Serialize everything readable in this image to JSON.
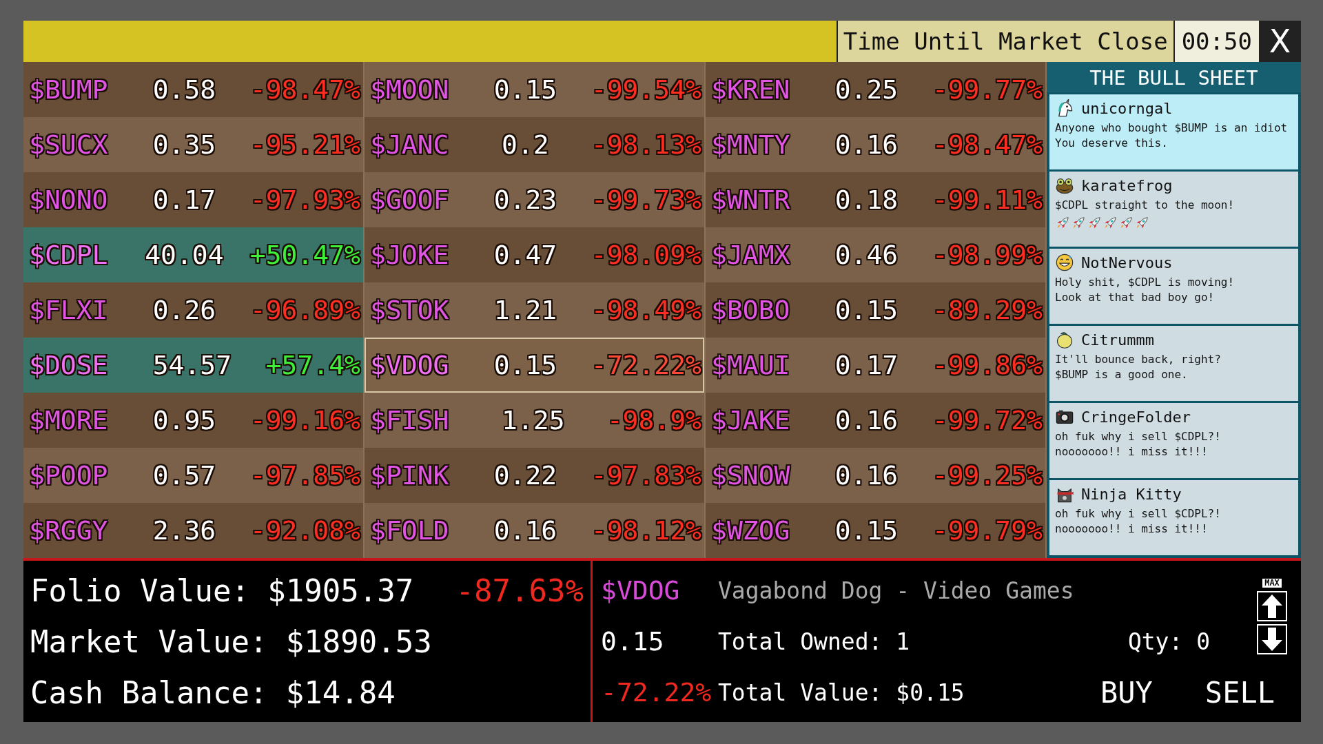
{
  "top_bar": {
    "label": "Time Until Market Close",
    "timer": "00:50",
    "close": "X"
  },
  "stocks": [
    {
      "ticker": "$BUMP",
      "price": "0.58",
      "change": "-98.47%",
      "rising": false,
      "selected": false
    },
    {
      "ticker": "$MOON",
      "price": "0.15",
      "change": "-99.54%",
      "rising": false,
      "selected": false
    },
    {
      "ticker": "$KREN",
      "price": "0.25",
      "change": "-99.77%",
      "rising": false,
      "selected": false
    },
    {
      "ticker": "$SUCX",
      "price": "0.35",
      "change": "-95.21%",
      "rising": false,
      "selected": false
    },
    {
      "ticker": "$JANC",
      "price": "0.2",
      "change": "-98.13%",
      "rising": false,
      "selected": false
    },
    {
      "ticker": "$MNTY",
      "price": "0.16",
      "change": "-98.47%",
      "rising": false,
      "selected": false
    },
    {
      "ticker": "$NONO",
      "price": "0.17",
      "change": "-97.93%",
      "rising": false,
      "selected": false
    },
    {
      "ticker": "$GOOF",
      "price": "0.23",
      "change": "-99.73%",
      "rising": false,
      "selected": false
    },
    {
      "ticker": "$WNTR",
      "price": "0.18",
      "change": "-99.11%",
      "rising": false,
      "selected": false
    },
    {
      "ticker": "$CDPL",
      "price": "40.04",
      "change": "+50.47%",
      "rising": true,
      "selected": false
    },
    {
      "ticker": "$JOKE",
      "price": "0.47",
      "change": "-98.09%",
      "rising": false,
      "selected": false
    },
    {
      "ticker": "$JAMX",
      "price": "0.46",
      "change": "-98.99%",
      "rising": false,
      "selected": false
    },
    {
      "ticker": "$FLXI",
      "price": "0.26",
      "change": "-96.89%",
      "rising": false,
      "selected": false
    },
    {
      "ticker": "$STOK",
      "price": "1.21",
      "change": "-98.49%",
      "rising": false,
      "selected": false
    },
    {
      "ticker": "$BOBO",
      "price": "0.15",
      "change": "-89.29%",
      "rising": false,
      "selected": false
    },
    {
      "ticker": "$DOSE",
      "price": "54.57",
      "change": "+57.4%",
      "rising": true,
      "selected": false
    },
    {
      "ticker": "$VDOG",
      "price": "0.15",
      "change": "-72.22%",
      "rising": false,
      "selected": true
    },
    {
      "ticker": "$MAUI",
      "price": "0.17",
      "change": "-99.86%",
      "rising": false,
      "selected": false
    },
    {
      "ticker": "$MORE",
      "price": "0.95",
      "change": "-99.16%",
      "rising": false,
      "selected": false
    },
    {
      "ticker": "$FISH",
      "price": "1.25",
      "change": "-98.9%",
      "rising": false,
      "selected": false
    },
    {
      "ticker": "$JAKE",
      "price": "0.16",
      "change": "-99.72%",
      "rising": false,
      "selected": false
    },
    {
      "ticker": "$POOP",
      "price": "0.57",
      "change": "-97.85%",
      "rising": false,
      "selected": false
    },
    {
      "ticker": "$PINK",
      "price": "0.22",
      "change": "-97.83%",
      "rising": false,
      "selected": false
    },
    {
      "ticker": "$SNOW",
      "price": "0.16",
      "change": "-99.25%",
      "rising": false,
      "selected": false
    },
    {
      "ticker": "$RGGY",
      "price": "2.36",
      "change": "-92.08%",
      "rising": false,
      "selected": false
    },
    {
      "ticker": "$FOLD",
      "price": "0.16",
      "change": "-98.12%",
      "rising": false,
      "selected": false
    },
    {
      "ticker": "$WZOG",
      "price": "0.15",
      "change": "-99.79%",
      "rising": false,
      "selected": false
    }
  ],
  "bull_sheet": {
    "title": "THE BULL SHEET",
    "posts": [
      {
        "kind": "unicorn",
        "user": "unicorngal",
        "text": "Anyone who bought $BUMP is an idiot\nYou deserve this.",
        "highlighted": true
      },
      {
        "kind": "frog",
        "user": "karatefrog",
        "text": "$CDPL straight to the moon!",
        "highlighted": false,
        "reactions": [
          {
            "kind": "rocket"
          },
          {
            "kind": "rocket"
          },
          {
            "kind": "rocket"
          },
          {
            "kind": "rocket"
          },
          {
            "kind": "rocket"
          },
          {
            "kind": "rocket"
          }
        ]
      },
      {
        "kind": "grin",
        "user": "NotNervous",
        "text": "Holy shit, $CDPL is moving!\nLook at that bad boy go!",
        "highlighted": false
      },
      {
        "kind": "lemon",
        "user": "Citrummm",
        "text": "It'll bounce back, right?\n$BUMP is a good one.",
        "highlighted": false
      },
      {
        "kind": "camera",
        "user": "CringeFolder",
        "text": "oh fuk why i sell $CDPL?!\nnooooooo!! i miss it!!!",
        "highlighted": false
      },
      {
        "kind": "cat",
        "user": "Ninja Kitty",
        "text": "oh fuk why i sell $CDPL?!\nnooooooo!! i miss it!!!",
        "highlighted": false
      }
    ]
  },
  "portfolio": {
    "rows": [
      {
        "label": "Folio Value: $1905.37",
        "change": "-87.63%"
      },
      {
        "label": "Market Value: $1890.53"
      },
      {
        "label": "Cash Balance: $14.84"
      }
    ]
  },
  "trade": {
    "ticker": "$VDOG",
    "name": "Vagabond Dog - Video Games",
    "price": "0.15",
    "change": "-72.22%",
    "owned": "Total Owned: 1",
    "value": "Total Value: $0.15",
    "qty": "Qty: 0",
    "max": "MAX",
    "buy": "BUY",
    "sell": "SELL"
  }
}
